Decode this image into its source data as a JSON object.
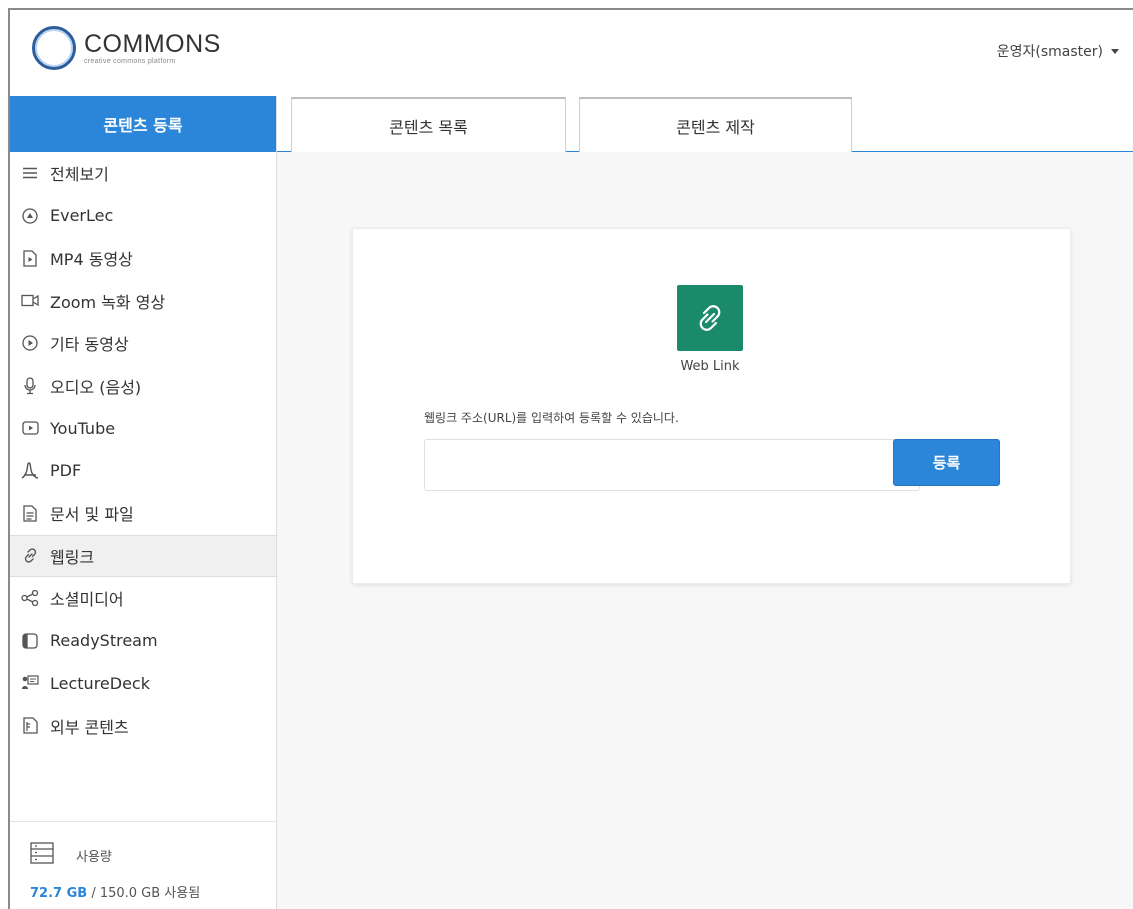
{
  "header": {
    "logo_title": "COMMONS",
    "logo_subtitle": "creative commons platform",
    "user_label": "운영자(smaster)"
  },
  "sidebar": {
    "title": "콘텐츠 등록",
    "items": [
      {
        "label": "전체보기",
        "icon": "menu-lines-icon"
      },
      {
        "label": "EverLec",
        "icon": "play-circle-icon"
      },
      {
        "label": "MP4 동영상",
        "icon": "video-file-icon"
      },
      {
        "label": "Zoom 녹화 영상",
        "icon": "video-camera-icon"
      },
      {
        "label": "기타 동영상",
        "icon": "play-circle-icon"
      },
      {
        "label": "오디오 (음성)",
        "icon": "microphone-icon"
      },
      {
        "label": "YouTube",
        "icon": "youtube-play-icon"
      },
      {
        "label": "PDF",
        "icon": "pdf-icon"
      },
      {
        "label": "문서 및 파일",
        "icon": "document-icon"
      },
      {
        "label": "웹링크",
        "icon": "link-icon",
        "active": true
      },
      {
        "label": "소셜미디어",
        "icon": "share-icon"
      },
      {
        "label": "ReadyStream",
        "icon": "readystream-icon"
      },
      {
        "label": "LectureDeck",
        "icon": "presentation-icon"
      },
      {
        "label": "외부 콘텐츠",
        "icon": "external-doc-icon"
      }
    ],
    "usage": {
      "label": "사용량",
      "used": "72.7 GB",
      "total": " / 150.0 GB 사용됨"
    }
  },
  "tabs": [
    {
      "label": "콘텐츠 목록"
    },
    {
      "label": "콘텐츠 제작"
    }
  ],
  "card": {
    "icon_label": "Web Link",
    "helper_text": "웹링크 주소(URL)를 입력하여 등록할 수 있습니다.",
    "url_value": "",
    "url_placeholder": "",
    "submit_label": "등록"
  },
  "colors": {
    "accent": "#2b86d9",
    "weblink_icon_bg": "#1b8a6b"
  }
}
